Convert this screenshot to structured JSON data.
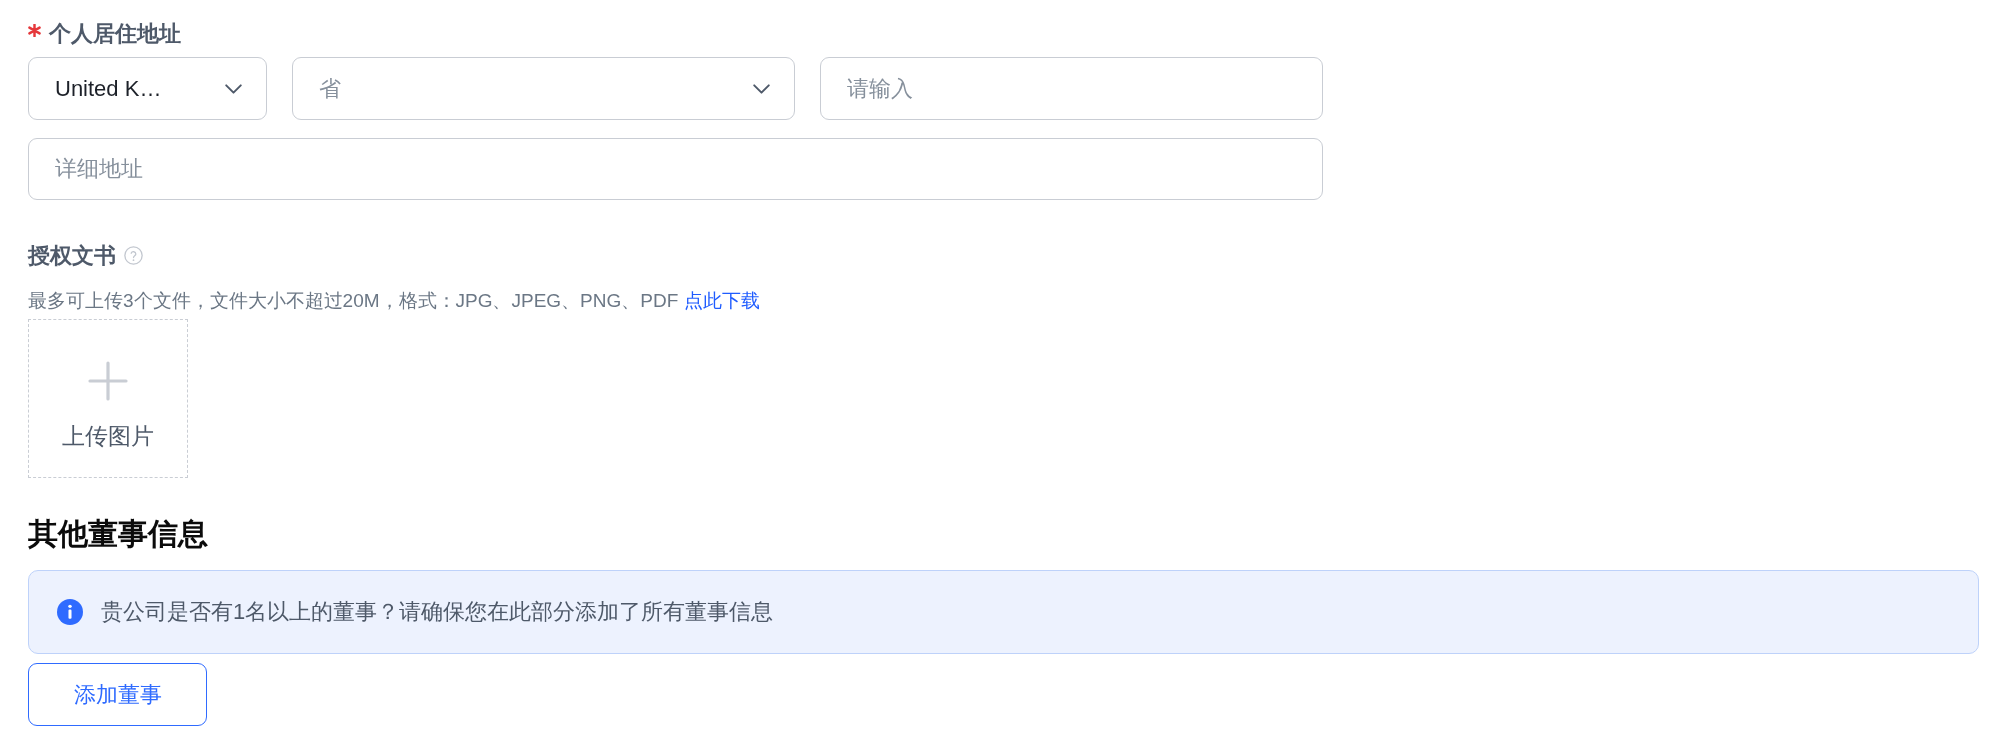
{
  "address_field": {
    "label": "个人居住地址",
    "required": true,
    "country_select": {
      "value": "United K…"
    },
    "province_select": {
      "placeholder": "省"
    },
    "city_input": {
      "placeholder": "请输入"
    },
    "detail_input": {
      "placeholder": "详细地址"
    }
  },
  "authorization_field": {
    "label": "授权文书",
    "hint": "最多可上传3个文件，文件大小不超过20M，格式：JPG、JPEG、PNG、PDF",
    "download_link": "点此下载",
    "upload": {
      "label": "上传图片"
    }
  },
  "directors_section": {
    "title": "其他董事信息",
    "alert": {
      "kind": "info",
      "text": "贵公司是否有1名以上的董事？请确保您在此部分添加了所有董事信息"
    },
    "add_button": "添加董事"
  }
}
